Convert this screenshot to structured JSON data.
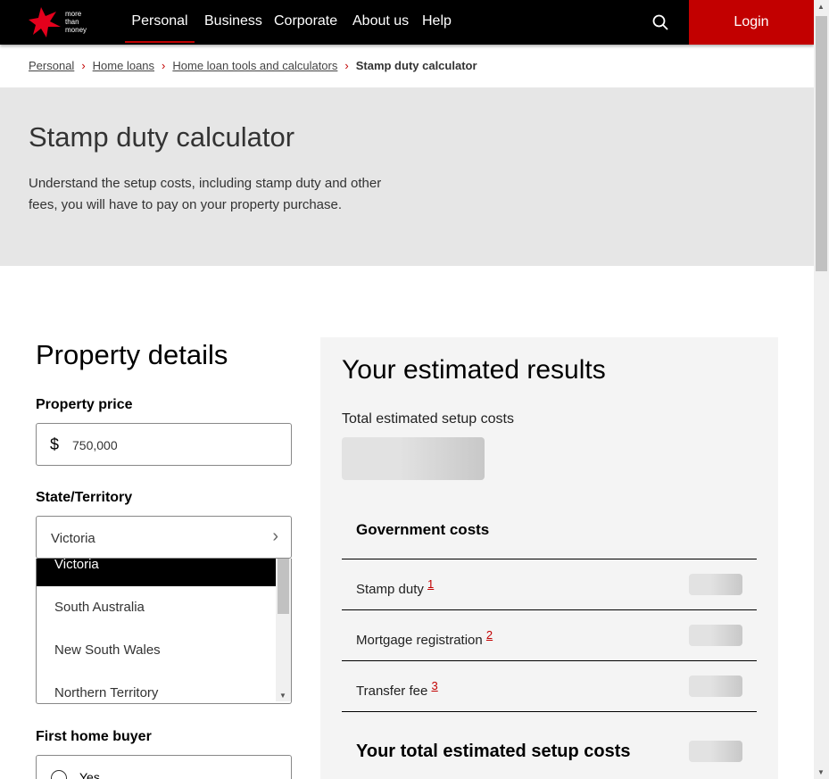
{
  "logo": {
    "text": [
      "more",
      "than",
      "money"
    ]
  },
  "nav": {
    "items": [
      "Personal",
      "Business",
      "Corporate",
      "About us",
      "Help"
    ],
    "login": "Login"
  },
  "breadcrumb": [
    "Personal",
    "Home loans",
    "Home loan tools and calculators",
    "Stamp duty calculator"
  ],
  "hero": {
    "title": "Stamp duty calculator",
    "desc": "Understand the setup costs, including stamp duty and other fees, you will have to pay on your property purchase."
  },
  "form": {
    "title": "Property details",
    "price_label": "Property price",
    "currency": "$",
    "price_value": "750,000",
    "state_label": "State/Territory",
    "state_value": "Victoria",
    "state_options": [
      "Victoria",
      "South Australia",
      "New South Wales",
      "Northern Territory"
    ],
    "fhb_label": "First home buyer",
    "fhb_yes": "Yes"
  },
  "results": {
    "title": "Your estimated results",
    "total_label": "Total estimated setup costs",
    "gov_title": "Government costs",
    "rows": [
      {
        "label": "Stamp duty",
        "note": "1"
      },
      {
        "label": "Mortgage registration",
        "note": "2"
      },
      {
        "label": "Transfer fee",
        "note": "3"
      }
    ],
    "grand_total": "Your total estimated setup costs"
  },
  "colors": {
    "brand": "#c20000"
  }
}
